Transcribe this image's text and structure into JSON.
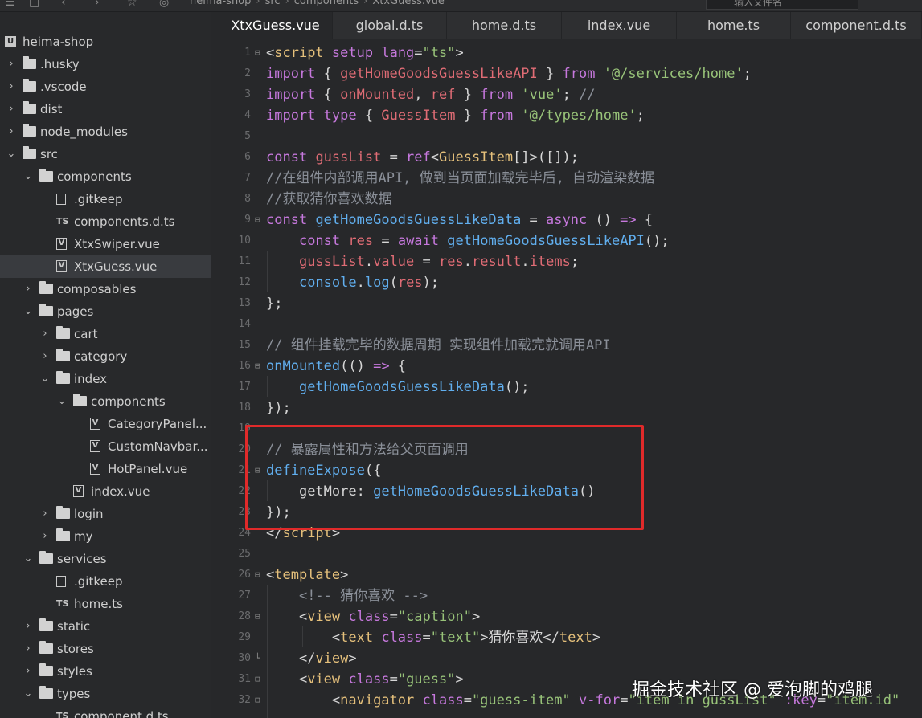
{
  "toolbar": {
    "breadcrumbs": [
      "heima-shop",
      "src",
      "components",
      "XtxGuess.vue"
    ],
    "search_placeholder": "输入文件名"
  },
  "sidebar": {
    "items": [
      {
        "label": "heima-shop",
        "type": "project",
        "depth": 0,
        "chevron": ""
      },
      {
        "label": ".husky",
        "type": "folder",
        "depth": 0,
        "chevron": "›"
      },
      {
        "label": ".vscode",
        "type": "folder",
        "depth": 0,
        "chevron": "›"
      },
      {
        "label": "dist",
        "type": "folder",
        "depth": 0,
        "chevron": "›"
      },
      {
        "label": "node_modules",
        "type": "folder",
        "depth": 0,
        "chevron": "›"
      },
      {
        "label": "src",
        "type": "folder",
        "depth": 0,
        "chevron": "⌄"
      },
      {
        "label": "components",
        "type": "folder",
        "depth": 1,
        "chevron": "⌄"
      },
      {
        "label": ".gitkeep",
        "type": "file",
        "depth": 2,
        "chevron": ""
      },
      {
        "label": "components.d.ts",
        "type": "ts",
        "depth": 2,
        "chevron": ""
      },
      {
        "label": "XtxSwiper.vue",
        "type": "vue",
        "depth": 2,
        "chevron": ""
      },
      {
        "label": "XtxGuess.vue",
        "type": "vue",
        "depth": 2,
        "chevron": "",
        "selected": true
      },
      {
        "label": "composables",
        "type": "folder",
        "depth": 1,
        "chevron": "›"
      },
      {
        "label": "pages",
        "type": "folder",
        "depth": 1,
        "chevron": "⌄"
      },
      {
        "label": "cart",
        "type": "folder",
        "depth": 2,
        "chevron": "›"
      },
      {
        "label": "category",
        "type": "folder",
        "depth": 2,
        "chevron": "›"
      },
      {
        "label": "index",
        "type": "folder",
        "depth": 2,
        "chevron": "⌄"
      },
      {
        "label": "components",
        "type": "folder",
        "depth": 3,
        "chevron": "⌄"
      },
      {
        "label": "CategoryPanel...",
        "type": "vue",
        "depth": 4,
        "chevron": ""
      },
      {
        "label": "CustomNavbar...",
        "type": "vue",
        "depth": 4,
        "chevron": ""
      },
      {
        "label": "HotPanel.vue",
        "type": "vue",
        "depth": 4,
        "chevron": ""
      },
      {
        "label": "index.vue",
        "type": "vue",
        "depth": 3,
        "chevron": ""
      },
      {
        "label": "login",
        "type": "folder",
        "depth": 2,
        "chevron": "›"
      },
      {
        "label": "my",
        "type": "folder",
        "depth": 2,
        "chevron": "›"
      },
      {
        "label": "services",
        "type": "folder",
        "depth": 1,
        "chevron": "⌄"
      },
      {
        "label": ".gitkeep",
        "type": "file",
        "depth": 2,
        "chevron": ""
      },
      {
        "label": "home.ts",
        "type": "ts",
        "depth": 2,
        "chevron": ""
      },
      {
        "label": "static",
        "type": "folder",
        "depth": 1,
        "chevron": "›"
      },
      {
        "label": "stores",
        "type": "folder",
        "depth": 1,
        "chevron": "›"
      },
      {
        "label": "styles",
        "type": "folder",
        "depth": 1,
        "chevron": "›"
      },
      {
        "label": "types",
        "type": "folder",
        "depth": 1,
        "chevron": "⌄"
      },
      {
        "label": "component.d.ts",
        "type": "ts",
        "depth": 2,
        "chevron": ""
      }
    ]
  },
  "tabs": [
    {
      "label": "XtxGuess.vue",
      "active": true
    },
    {
      "label": "global.d.ts"
    },
    {
      "label": "home.d.ts"
    },
    {
      "label": "index.vue"
    },
    {
      "label": "home.ts"
    },
    {
      "label": "component.d.ts"
    }
  ],
  "editor": {
    "lines": [
      {
        "n": "1",
        "fold": "⊟",
        "tokens": [
          [
            "pn",
            "<"
          ],
          [
            "tag",
            "script"
          ],
          [
            "attr",
            " setup"
          ],
          [
            "pn",
            " "
          ],
          [
            "attr",
            "lang"
          ],
          [
            "pn",
            "="
          ],
          [
            "str",
            "\"ts\""
          ],
          [
            "pn",
            ">"
          ]
        ]
      },
      {
        "n": "2",
        "tokens": [
          [
            "kw",
            "import"
          ],
          [
            "pn",
            " { "
          ],
          [
            "var",
            "getHomeGoodsGuessLikeAPI"
          ],
          [
            "pn",
            " } "
          ],
          [
            "kw",
            "from"
          ],
          [
            "pn",
            " "
          ],
          [
            "str",
            "'@/services/home'"
          ],
          [
            "pn",
            ";"
          ]
        ]
      },
      {
        "n": "3",
        "tokens": [
          [
            "kw",
            "import"
          ],
          [
            "pn",
            " { "
          ],
          [
            "var",
            "onMounted"
          ],
          [
            "pn",
            ", "
          ],
          [
            "var",
            "ref"
          ],
          [
            "pn",
            " } "
          ],
          [
            "kw",
            "from"
          ],
          [
            "pn",
            " "
          ],
          [
            "str",
            "'vue'"
          ],
          [
            "pn",
            "; "
          ],
          [
            "cm",
            "//"
          ]
        ]
      },
      {
        "n": "4",
        "tokens": [
          [
            "kw",
            "import"
          ],
          [
            "pn",
            " "
          ],
          [
            "kw",
            "type"
          ],
          [
            "pn",
            " { "
          ],
          [
            "var",
            "GuessItem"
          ],
          [
            "pn",
            " } "
          ],
          [
            "kw",
            "from"
          ],
          [
            "pn",
            " "
          ],
          [
            "str",
            "'@/types/home'"
          ],
          [
            "pn",
            ";"
          ]
        ]
      },
      {
        "n": "5",
        "tokens": []
      },
      {
        "n": "6",
        "tokens": [
          [
            "kw",
            "const"
          ],
          [
            "pn",
            " "
          ],
          [
            "var",
            "gussList"
          ],
          [
            "pn",
            " = "
          ],
          [
            "kw",
            "ref"
          ],
          [
            "pn",
            "<"
          ],
          [
            "typ",
            "GuessItem"
          ],
          [
            "pn",
            "[]>([]);"
          ]
        ]
      },
      {
        "n": "7",
        "tokens": [
          [
            "cm",
            "//在组件内部调用API, 做到当页面加载完毕后, 自动渲染数据"
          ]
        ]
      },
      {
        "n": "8",
        "tokens": [
          [
            "cm",
            "//获取猜你喜欢数据"
          ]
        ]
      },
      {
        "n": "9",
        "fold": "⊟",
        "tokens": [
          [
            "kw",
            "const"
          ],
          [
            "pn",
            " "
          ],
          [
            "fn",
            "getHomeGoodsGuessLikeData"
          ],
          [
            "pn",
            " = "
          ],
          [
            "kw",
            "async"
          ],
          [
            "pn",
            " () "
          ],
          [
            "kw",
            "=>"
          ],
          [
            "pn",
            " {"
          ]
        ]
      },
      {
        "n": "10",
        "tokens": [
          [
            "pn",
            "    "
          ],
          [
            "kw",
            "const"
          ],
          [
            "pn",
            " "
          ],
          [
            "var",
            "res"
          ],
          [
            "pn",
            " = "
          ],
          [
            "kw",
            "await"
          ],
          [
            "pn",
            " "
          ],
          [
            "fn",
            "getHomeGoodsGuessLikeAPI"
          ],
          [
            "pn",
            "();"
          ]
        ]
      },
      {
        "n": "11",
        "tokens": [
          [
            "pn",
            "    "
          ],
          [
            "var",
            "gussList"
          ],
          [
            "pn",
            "."
          ],
          [
            "var",
            "value"
          ],
          [
            "pn",
            " = "
          ],
          [
            "var",
            "res"
          ],
          [
            "pn",
            "."
          ],
          [
            "var",
            "result"
          ],
          [
            "pn",
            "."
          ],
          [
            "var",
            "items"
          ],
          [
            "pn",
            ";"
          ]
        ]
      },
      {
        "n": "12",
        "tokens": [
          [
            "pn",
            "    "
          ],
          [
            "fn",
            "console"
          ],
          [
            "pn",
            "."
          ],
          [
            "fn",
            "log"
          ],
          [
            "pn",
            "("
          ],
          [
            "var",
            "res"
          ],
          [
            "pn",
            ");"
          ]
        ]
      },
      {
        "n": "13",
        "tokens": [
          [
            "pn",
            "};"
          ]
        ]
      },
      {
        "n": "14",
        "tokens": []
      },
      {
        "n": "15",
        "tokens": [
          [
            "cm",
            "// 组件挂载完毕的数据周期 实现组件加载完就调用API"
          ]
        ]
      },
      {
        "n": "16",
        "fold": "⊟",
        "tokens": [
          [
            "fn",
            "onMounted"
          ],
          [
            "pn",
            "(() "
          ],
          [
            "kw",
            "=>"
          ],
          [
            "pn",
            " {"
          ]
        ]
      },
      {
        "n": "17",
        "tokens": [
          [
            "pn",
            "    "
          ],
          [
            "fn",
            "getHomeGoodsGuessLikeData"
          ],
          [
            "pn",
            "();"
          ]
        ]
      },
      {
        "n": "18",
        "tokens": [
          [
            "pn",
            "});"
          ]
        ]
      },
      {
        "n": "19",
        "tokens": []
      },
      {
        "n": "20",
        "tokens": [
          [
            "cm",
            "// 暴露属性和方法给父页面调用"
          ]
        ]
      },
      {
        "n": "21",
        "fold": "⊟",
        "tokens": [
          [
            "fn",
            "defineExpose"
          ],
          [
            "pn",
            "({"
          ]
        ]
      },
      {
        "n": "22",
        "tokens": [
          [
            "pn",
            "    "
          ],
          [
            "prop",
            "getMore"
          ],
          [
            "pn",
            ": "
          ],
          [
            "fn",
            "getHomeGoodsGuessLikeData"
          ],
          [
            "pn",
            "()"
          ]
        ]
      },
      {
        "n": "23",
        "tokens": [
          [
            "pn",
            "});"
          ]
        ]
      },
      {
        "n": "24",
        "tokens": [
          [
            "pn",
            "</"
          ],
          [
            "tag",
            "script"
          ],
          [
            "pn",
            ">"
          ]
        ]
      },
      {
        "n": "25",
        "tokens": []
      },
      {
        "n": "26",
        "fold": "⊟",
        "tokens": [
          [
            "pn",
            "<"
          ],
          [
            "tag",
            "template"
          ],
          [
            "pn",
            ">"
          ]
        ]
      },
      {
        "n": "27",
        "tokens": [
          [
            "pn",
            "    "
          ],
          [
            "cm",
            "<!-- 猜你喜欢 -->"
          ]
        ]
      },
      {
        "n": "28",
        "fold": "⊟",
        "tokens": [
          [
            "pn",
            "    <"
          ],
          [
            "tag",
            "view"
          ],
          [
            "pn",
            " "
          ],
          [
            "attr",
            "class"
          ],
          [
            "pn",
            "="
          ],
          [
            "str",
            "\"caption\""
          ],
          [
            "pn",
            ">"
          ]
        ]
      },
      {
        "n": "29",
        "tokens": [
          [
            "pn",
            "        <"
          ],
          [
            "tag",
            "text"
          ],
          [
            "pn",
            " "
          ],
          [
            "attr",
            "class"
          ],
          [
            "pn",
            "="
          ],
          [
            "str",
            "\"text\""
          ],
          [
            "pn",
            ">猜你喜欢</"
          ],
          [
            "tag",
            "text"
          ],
          [
            "pn",
            ">"
          ]
        ]
      },
      {
        "n": "30",
        "fold": "└",
        "tokens": [
          [
            "pn",
            "    </"
          ],
          [
            "tag",
            "view"
          ],
          [
            "pn",
            ">"
          ]
        ]
      },
      {
        "n": "31",
        "fold": "⊟",
        "tokens": [
          [
            "pn",
            "    <"
          ],
          [
            "tag",
            "view"
          ],
          [
            "pn",
            " "
          ],
          [
            "attr",
            "class"
          ],
          [
            "pn",
            "="
          ],
          [
            "str",
            "\"guess\""
          ],
          [
            "pn",
            ">"
          ]
        ]
      },
      {
        "n": "32",
        "fold": "⊟",
        "tokens": [
          [
            "pn",
            "        <"
          ],
          [
            "tag",
            "navigator"
          ],
          [
            "pn",
            " "
          ],
          [
            "attr",
            "class"
          ],
          [
            "pn",
            "="
          ],
          [
            "str",
            "\"guess-item\""
          ],
          [
            "pn",
            " "
          ],
          [
            "attr",
            "v-for"
          ],
          [
            "pn",
            "="
          ],
          [
            "str",
            "\"item in gussList\""
          ],
          [
            "pn",
            " "
          ],
          [
            "attr",
            ":key"
          ],
          [
            "pn",
            "="
          ],
          [
            "str",
            "\"item.id\""
          ]
        ]
      }
    ]
  },
  "watermark": "掘金技术社区 @ 爱泡脚的鸡腿",
  "colors": {
    "highlight": "#e02a2a",
    "background": "#27282a",
    "selected_row": "#393b3f"
  }
}
